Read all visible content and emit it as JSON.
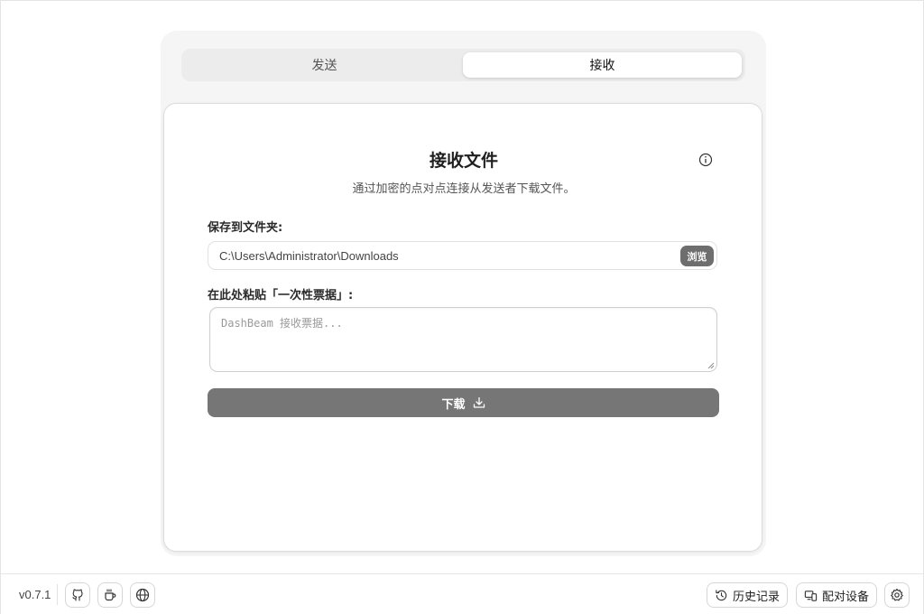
{
  "tabs": {
    "send_label": "发送",
    "receive_label": "接收"
  },
  "card": {
    "title": "接收文件",
    "subtitle": "通过加密的点对点连接从发送者下载文件。",
    "save_label": "保存到文件夹:",
    "save_path": "C:\\Users\\Administrator\\Downloads",
    "browse_label": "浏览",
    "ticket_label": "在此处粘贴「一次性票据」:",
    "ticket_placeholder": "DashBeam 接收票据...",
    "download_label": "下载"
  },
  "footer": {
    "version": "v0.7.1",
    "history_label": "历史记录",
    "pair_label": "配对设备"
  },
  "icons": [
    "info-icon",
    "github-icon",
    "coffee-icon",
    "globe-icon",
    "download-icon",
    "history-icon",
    "pair-devices-icon",
    "gear-icon"
  ],
  "colors": {
    "primary_button": "#767676",
    "browse_button": "#6e6e6e",
    "background_panel": "#f5f5f5"
  }
}
